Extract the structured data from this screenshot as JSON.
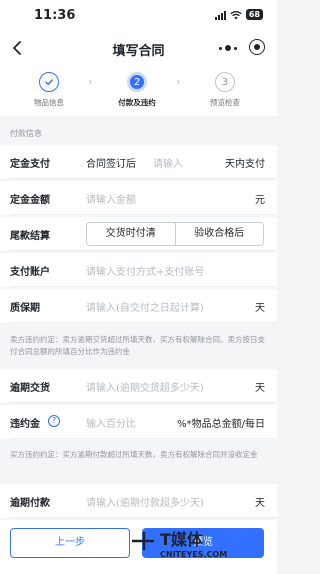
{
  "status_bar": {
    "time": "11:36",
    "battery": "68"
  },
  "nav": {
    "title": "填写合同"
  },
  "steps": [
    {
      "number": "1",
      "label": "物品信息",
      "state": "done"
    },
    {
      "number": "2",
      "label": "付款及违约",
      "state": "active"
    },
    {
      "number": "3",
      "label": "预览检查",
      "state": "todo"
    }
  ],
  "payment_section": {
    "label": "付款信息"
  },
  "deposit_payment": {
    "label": "定金支付",
    "prefix": "合同签订后",
    "placeholder": "请输入",
    "suffix": "天内支付"
  },
  "deposit_amount": {
    "label": "定金金额",
    "placeholder": "请输入金额",
    "unit": "元"
  },
  "final_settlement": {
    "label": "尾款结算",
    "options": [
      "交货时付清",
      "验收合格后"
    ]
  },
  "pay_account": {
    "label": "支付账户",
    "placeholder": "请输入支付方式+支付账号"
  },
  "warranty": {
    "label": "质保期",
    "placeholder": "请输入(自交付之日起计算)",
    "unit": "天"
  },
  "seller_note": "卖方违约约定：卖方逾期交货超过所填天数，买方有权解除合同。卖方按日支付合同总额的所填百分比作为违约金",
  "late_delivery": {
    "label": "逾期交货",
    "placeholder": "请输入(逾期交货超多少天)",
    "unit": "天"
  },
  "penalty": {
    "label": "违约金",
    "placeholder": "输入百分比",
    "unit": "%*物品总金额/每日"
  },
  "buyer_note": "买方违约约定：买方逾期付款超过所填天数，卖方有权解除合同并没收定金",
  "late_payment": {
    "label": "逾期付款",
    "placeholder": "请输入(逾期付款超多少天)",
    "unit": "天"
  },
  "footer": {
    "prev_label": "上一步",
    "next_label": "预览"
  },
  "watermark": {
    "logo_text": "T媒体",
    "site": "CNITEYES.COM"
  },
  "colors": {
    "accent": "#3370ff",
    "text": "#1f2329",
    "placeholder": "#b7bbc2",
    "background": "#f4f5f7"
  }
}
